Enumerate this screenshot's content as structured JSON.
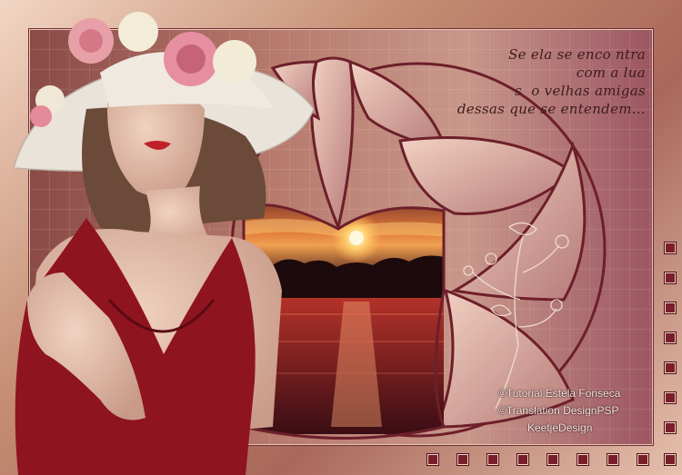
{
  "poem": {
    "lines": [
      "Se ela se enco ntra",
      "com a lua",
      "s  o velhas amigas",
      "dessas que se entendem..."
    ]
  },
  "credits": {
    "tutorial": "©Tutorial Estela Fonseca",
    "translation": "©Translation DesignPSP",
    "designer": "KeetjeDesign"
  },
  "colors": {
    "accent": "#7a1e2a",
    "dress": "#8e1420",
    "sunset": "#e0502a"
  }
}
